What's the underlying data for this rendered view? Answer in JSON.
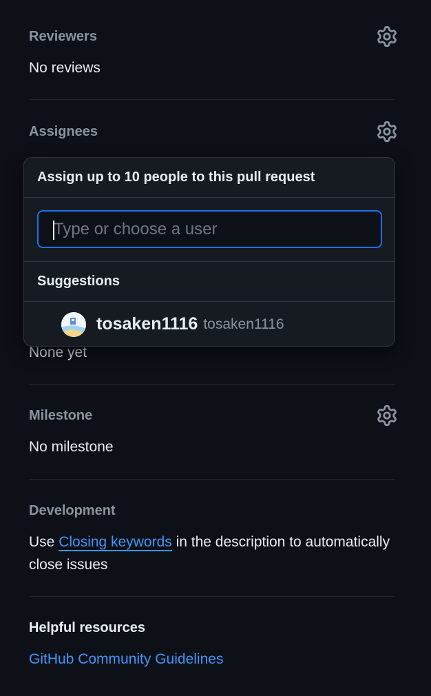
{
  "reviewers": {
    "title": "Reviewers",
    "value": "No reviews",
    "gear_icon": "gear-icon"
  },
  "assignees": {
    "title": "Assignees",
    "value": "None yet",
    "gear_icon": "gear-icon"
  },
  "milestone": {
    "title": "Milestone",
    "value": "No milestone",
    "gear_icon": "gear-icon"
  },
  "development": {
    "title": "Development",
    "text_before": "Use ",
    "link_text": "Closing keywords",
    "text_after": " in the description to automatically close issues"
  },
  "helpful": {
    "title": "Helpful resources",
    "link_text": "GitHub Community Guidelines"
  },
  "assign_popover": {
    "header": "Assign up to 10 people to this pull request",
    "filter_placeholder": "Type or choose a user",
    "filter_value": "",
    "suggestions_title": "Suggestions",
    "suggestions": [
      {
        "login": "tosaken1116",
        "name": "tosaken1116",
        "avatar": "avatar"
      }
    ]
  },
  "colors": {
    "background": "#0d1117",
    "overlay": "#161b22",
    "border": "#30363d",
    "text_primary": "#e6edf3",
    "text_muted": "#8b949e",
    "link": "#4493f8",
    "focus": "#1f6feb"
  }
}
